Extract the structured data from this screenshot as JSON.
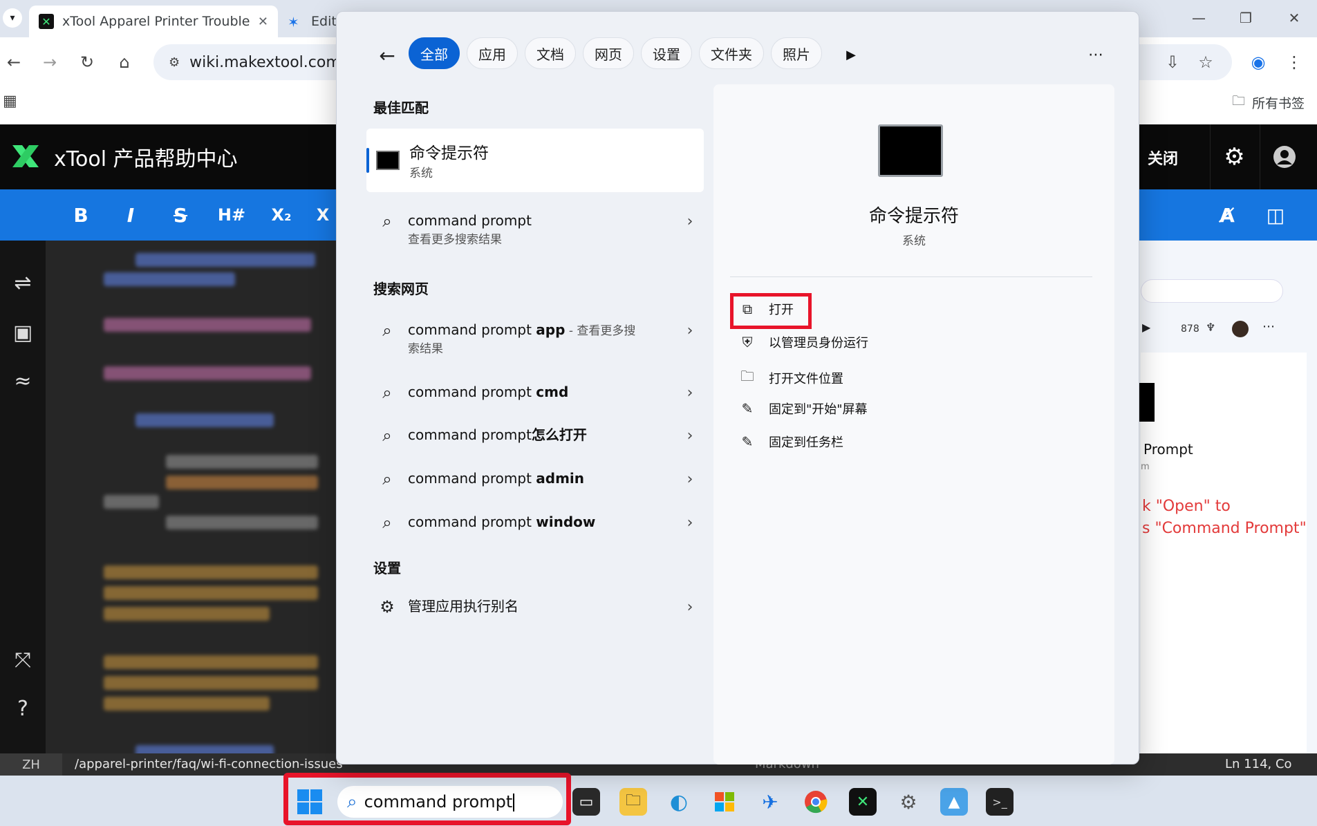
{
  "browser": {
    "tabs": [
      {
        "title": "xTool Apparel Printer Trouble",
        "icon": "xtool-logo-icon"
      },
      {
        "title": "Edit",
        "icon": "wiki-logo-icon"
      }
    ],
    "url": "wiki.makextool.com/e",
    "bookmarks_label": "所有书签"
  },
  "xtool": {
    "title": "xTool 产品帮助中心",
    "close_label": "关闭",
    "format_buttons": [
      "B",
      "I",
      "S",
      "H#",
      "X₂",
      "X"
    ]
  },
  "status": {
    "lang": "ZH",
    "path": "/apparel-printer/faq/wi-fi-connection-issues",
    "mode": "Markdown",
    "position": "Ln 114, Co"
  },
  "preview": {
    "count": "878",
    "prompt_label": "Prompt",
    "prompt_sub": "m",
    "red_line1": "k \"Open\" to",
    "red_line2": "s \"Command Prompt\""
  },
  "search_flyout": {
    "filters": [
      "全部",
      "应用",
      "文档",
      "网页",
      "设置",
      "文件夹",
      "照片"
    ],
    "best_match_heading": "最佳匹配",
    "best_match": {
      "title": "命令提示符",
      "subtitle": "系统"
    },
    "more_results": {
      "title": "command prompt",
      "subtitle": "查看更多搜索结果"
    },
    "web_heading": "搜索网页",
    "web_results": [
      {
        "prefix": "command prompt ",
        "bold": "app",
        "suffix": " - 查看更多搜",
        "suffix2": "索结果"
      },
      {
        "prefix": "command prompt ",
        "bold": "cmd"
      },
      {
        "prefix": "command prompt",
        "bold": "怎么打开"
      },
      {
        "prefix": "command prompt ",
        "bold": "admin"
      },
      {
        "prefix": "command prompt ",
        "bold": "window"
      }
    ],
    "settings_heading": "设置",
    "settings_result": "管理应用执行别名",
    "detail": {
      "title": "命令提示符",
      "subtitle": "系统",
      "actions": [
        "打开",
        "以管理员身份运行",
        "打开文件位置",
        "固定到\"开始\"屏幕",
        "固定到任务栏"
      ]
    }
  },
  "taskbar": {
    "search_value": "command prompt"
  }
}
